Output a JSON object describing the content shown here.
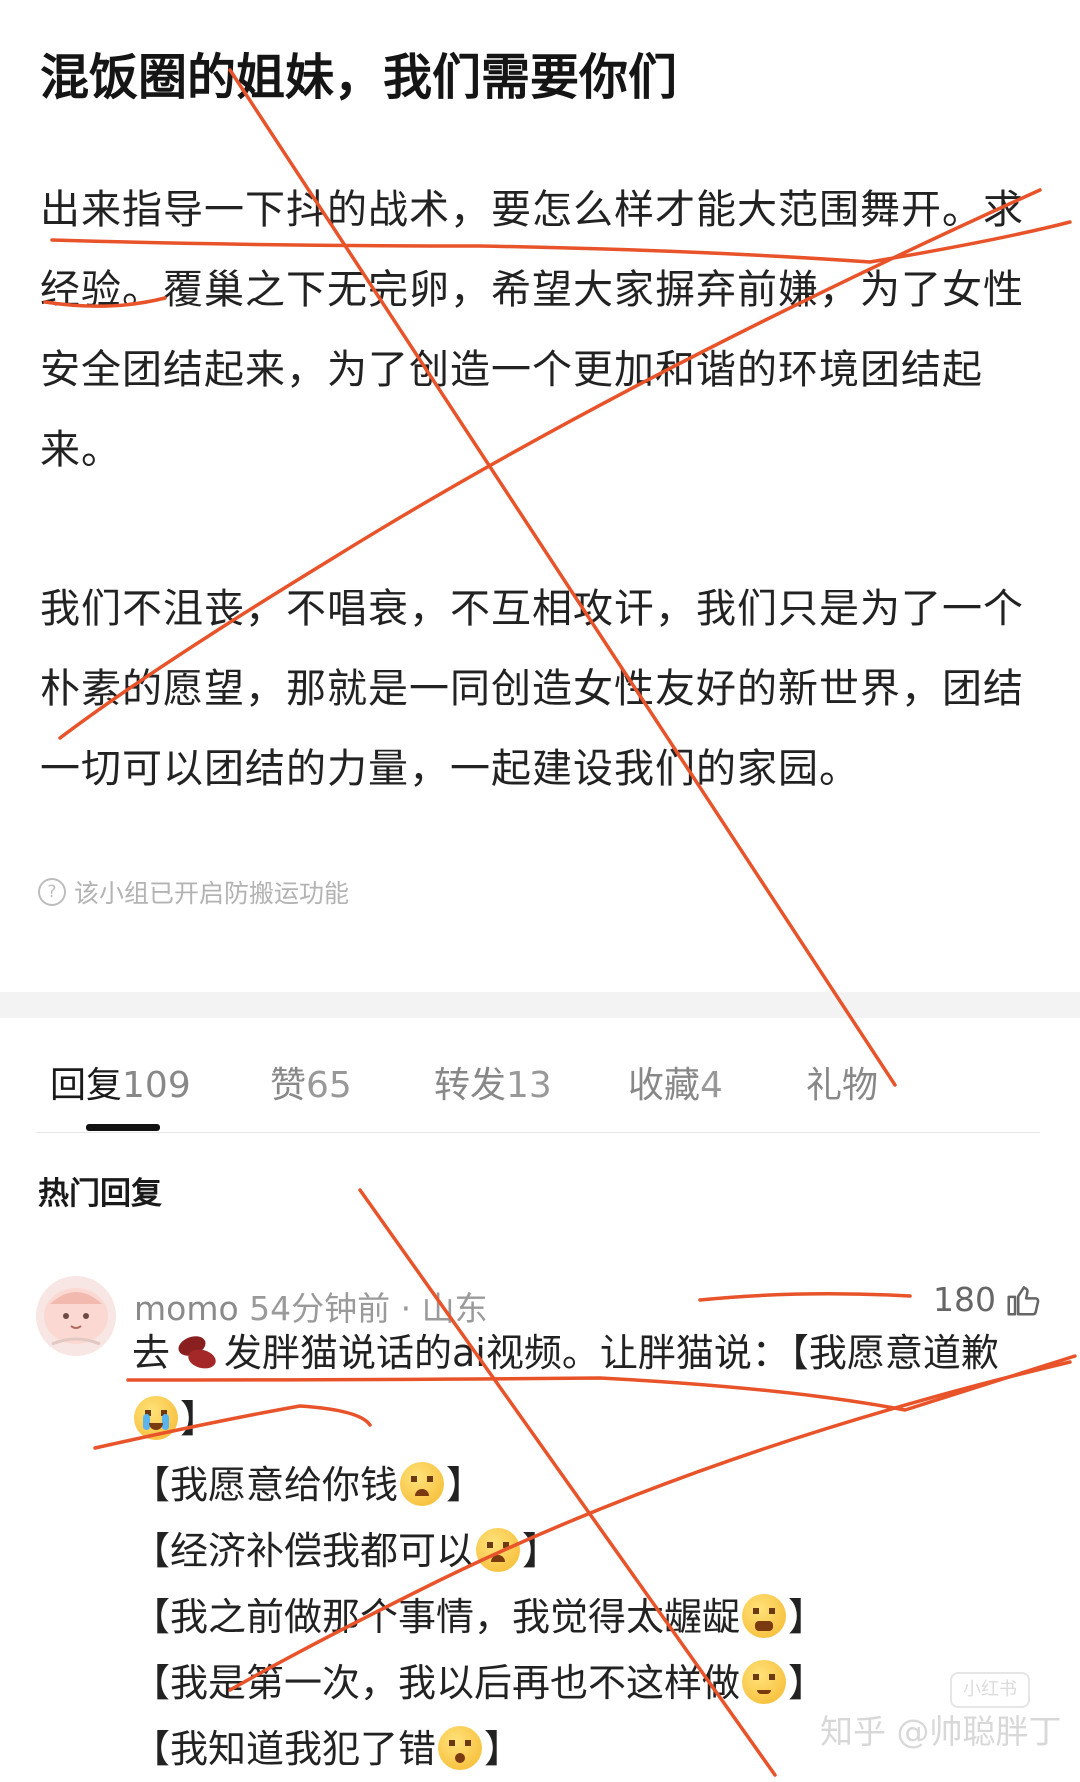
{
  "post": {
    "title": "混饭圈的姐妹，我们需要你们",
    "paragraph1": "出来指导一下抖的战术，要怎么样才能大范围舞开。求经验。覆巢之下无完卵，希望大家摒弃前嫌，为了女性安全团结起来，为了创造一个更加和谐的环境团结起来。",
    "paragraph2": "我们不沮丧，不唱衰，不互相攻讦，我们只是为了一个朴素的愿望，那就是一同创造女性友好的新世界，团结一切可以团结的力量，一起建设我们的家园。",
    "notice": "该小组已开启防搬运功能"
  },
  "tabs": [
    {
      "label": "回复",
      "count": "109"
    },
    {
      "label": "赞",
      "count": "65"
    },
    {
      "label": "转发",
      "count": "13"
    },
    {
      "label": "收藏",
      "count": "4"
    },
    {
      "label": "礼物",
      "count": ""
    }
  ],
  "hot_replies_title": "热门回复",
  "comment": {
    "user": "momo",
    "meta": "54分钟前 · 山东",
    "likes": "180",
    "line1a": "去",
    "line1b": "发胖猫说话的ai视频。让胖猫说：【我愿意道歉",
    "line1c": "】",
    "line2a": "【我愿意给你钱",
    "line2b": "】",
    "line3a": "【经济补偿我都可以",
    "line3b": "】",
    "line4a": "【我之前做那个事情，我觉得太龌龊",
    "line4b": "】",
    "line5a": "【我是第一次，我以后再也不这样做",
    "line5b": "】",
    "line6a": "【我知道我犯了错",
    "line6b": "】"
  },
  "watermark": {
    "text": "知乎 @帅聪胖丁",
    "badge": "小红书"
  },
  "colors": {
    "annotation": "#e8532a",
    "accent": "#111111"
  }
}
